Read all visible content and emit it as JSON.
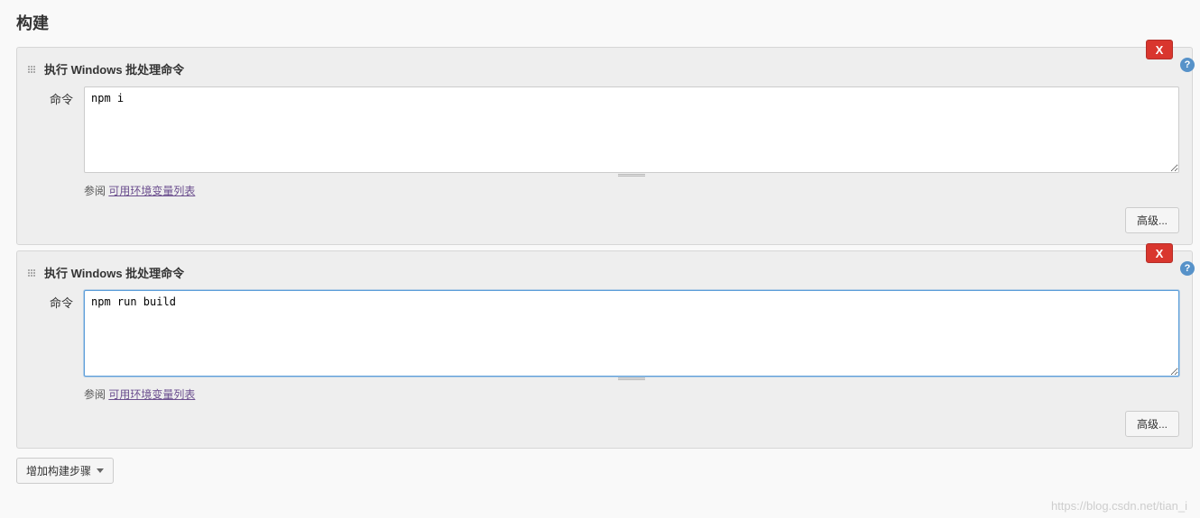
{
  "section_title": "构建",
  "steps": [
    {
      "title": "执行 Windows 批处理命令",
      "delete_label": "X",
      "help_icon": "?",
      "field_label": "命令",
      "command_value": "npm i",
      "help_prefix": "参阅 ",
      "help_link_text": "可用环境变量列表",
      "advanced_label": "高级...",
      "focused": false
    },
    {
      "title": "执行 Windows 批处理命令",
      "delete_label": "X",
      "help_icon": "?",
      "field_label": "命令",
      "command_value": "npm run build",
      "help_prefix": "参阅 ",
      "help_link_text": "可用环境变量列表",
      "advanced_label": "高级...",
      "focused": true
    }
  ],
  "add_step_label": "增加构建步骤",
  "watermark": "https://blog.csdn.net/tian_i"
}
